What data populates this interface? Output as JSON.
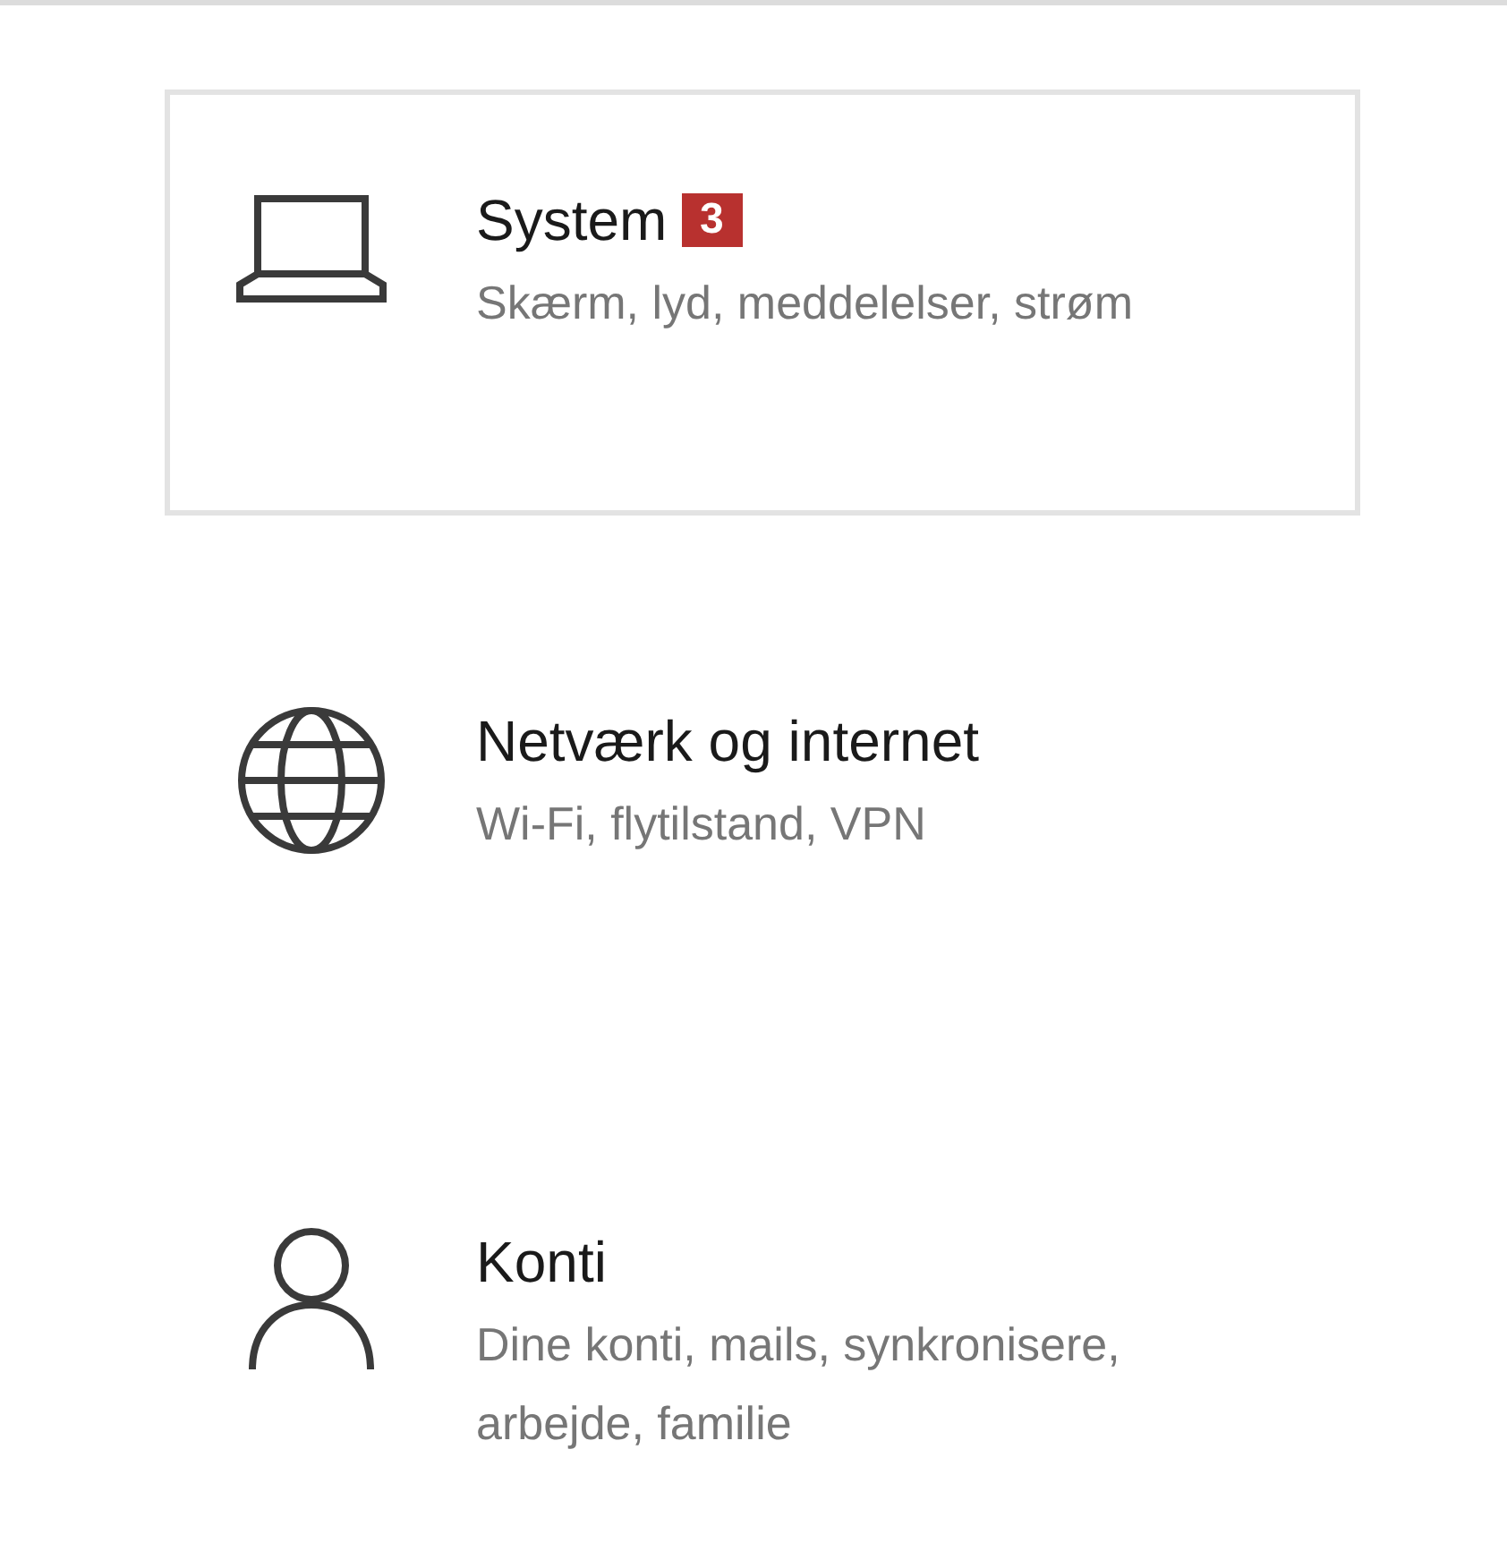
{
  "items": [
    {
      "kind": "laptop",
      "title": "System",
      "badge": "3",
      "subtitle": "Skærm, lyd, meddelelser, strøm",
      "selected": true
    },
    {
      "kind": "globe",
      "title": "Netværk og internet",
      "subtitle": "Wi-Fi, flytilstand, VPN",
      "selected": false
    },
    {
      "kind": "person",
      "title": "Konti",
      "subtitle": "Dine konti, mails, synkronisere, arbejde, familie",
      "selected": false
    }
  ]
}
